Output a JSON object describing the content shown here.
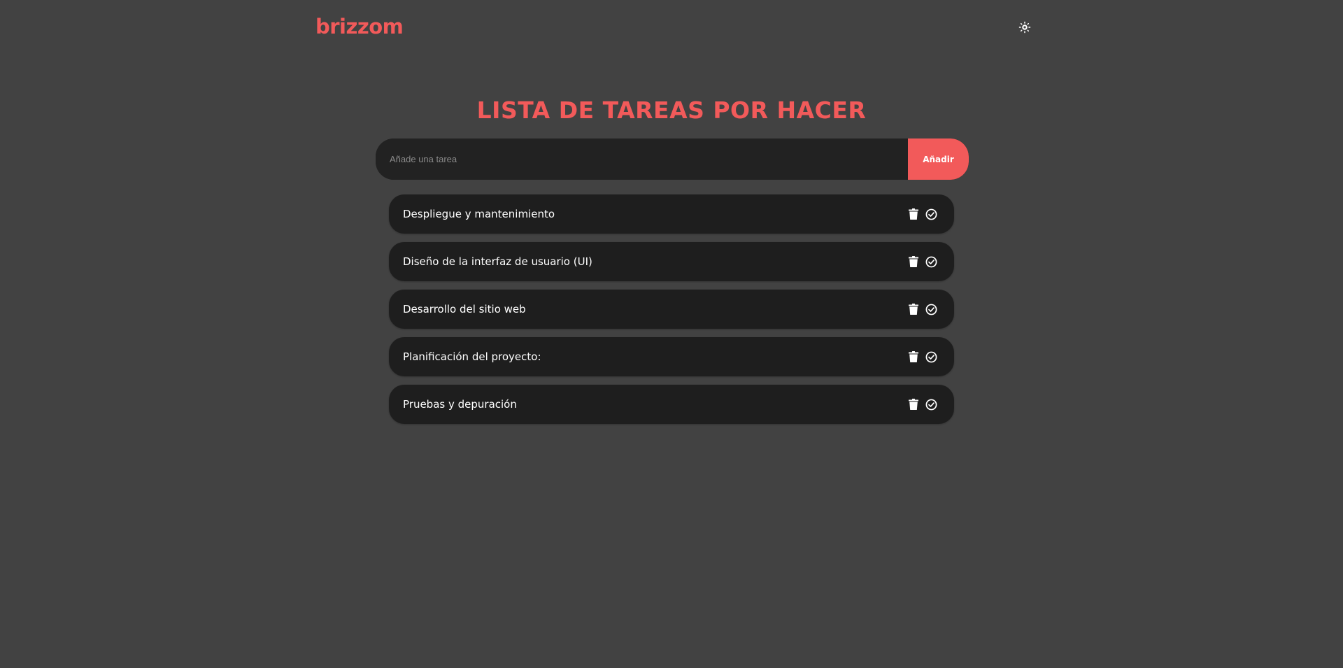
{
  "header": {
    "logo": "brizzom",
    "theme_toggle_icon": "sun-icon"
  },
  "main": {
    "title": "LISTA DE TAREAS POR HACER",
    "add_form": {
      "placeholder": "Añade una tarea",
      "value": "",
      "button_label": "Añadir"
    },
    "tasks": [
      {
        "text": "Despliegue y mantenimiento",
        "delete_icon": "trash-icon",
        "complete_icon": "check-circle-icon"
      },
      {
        "text": "Diseño de la interfaz de usuario (UI)",
        "delete_icon": "trash-icon",
        "complete_icon": "check-circle-icon"
      },
      {
        "text": "Desarrollo del sitio web",
        "delete_icon": "trash-icon",
        "complete_icon": "check-circle-icon"
      },
      {
        "text": "Planificación del proyecto:",
        "delete_icon": "trash-icon",
        "complete_icon": "check-circle-icon"
      },
      {
        "text": "Pruebas y depuración",
        "delete_icon": "trash-icon",
        "complete_icon": "check-circle-icon"
      }
    ]
  },
  "colors": {
    "background": "#424242",
    "accent": "#f25a5a",
    "surface": "#1e1e1e",
    "text": "#ffffff"
  }
}
